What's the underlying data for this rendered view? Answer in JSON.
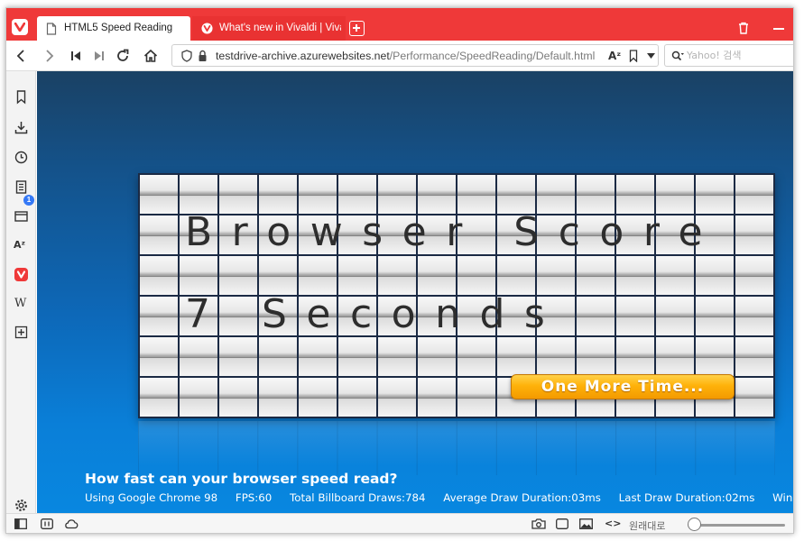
{
  "colors": {
    "accent": "#ef3939",
    "content_top": "#1a4164",
    "content_bottom": "#0887e0",
    "button": "#ffb20a"
  },
  "tabs": [
    {
      "label": "HTML5 Speed Reading",
      "active": true,
      "icon": "page-icon"
    },
    {
      "label": "What's new in Vivaldi | Vivaldi",
      "active": false,
      "icon": "vivaldi-icon"
    }
  ],
  "address": {
    "url_host": "testdrive-archive.azurewebsites.net",
    "url_path": "/Performance/SpeedReading/Default.html",
    "search_placeholder": "Yahoo! 검색"
  },
  "sidepanel": {
    "items": [
      "bookmarks-icon",
      "downloads-icon",
      "history-icon",
      "notes-icon",
      "window-panel-icon",
      "translate-icon",
      "vivaldi-icon",
      "wikipedia-icon",
      "add-panel-icon"
    ],
    "badge": "1",
    "wiki_glyph": "W"
  },
  "board": {
    "line1": "Browser Score",
    "line2": "7 Seconds",
    "button": "One More Time..."
  },
  "page": {
    "headline": "How fast can your browser speed read?",
    "stats": [
      "Using Google Chrome 98",
      "FPS:60",
      "Total Billboard Draws:784",
      "Average Draw Duration:03ms",
      "Last Draw Duration:02ms",
      "Window Size"
    ]
  },
  "statusbar": {
    "zoom_label": "원래대로",
    "zoom_level": 0.02
  }
}
